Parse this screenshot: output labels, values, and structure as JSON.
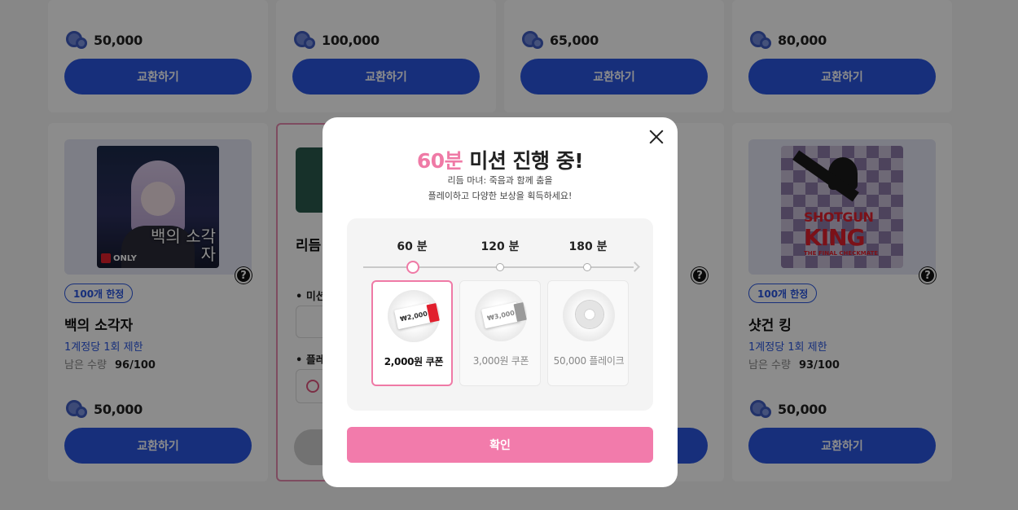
{
  "cards_top": [
    {
      "price": "50,000",
      "button": "교환하기"
    },
    {
      "price": "100,000",
      "button": "교환하기"
    },
    {
      "price": "65,000",
      "button": "교환하기"
    },
    {
      "price": "80,000",
      "button": "교환하기"
    }
  ],
  "cards_bottom": [
    {
      "badge": "100개 한정",
      "title": "백의 소각자",
      "limit": "1계정당 1회 제한",
      "remain_label": "남은 수량",
      "remain_value": "96/100",
      "price": "50,000",
      "button": "교환하기",
      "art_text": "백의 소각자",
      "art_tag": "ONLY"
    },
    {
      "title_partial": "리듬",
      "mission_partial": "미션",
      "play_partial": "플레"
    },
    {},
    {
      "badge": "100개 한정",
      "title": "샷건 킹",
      "limit": "1계정당 1회 제한",
      "remain_label": "남은 수량",
      "remain_value": "93/100",
      "price": "50,000",
      "button": "교환하기",
      "art_text_1": "SHOTGUN",
      "art_text_2": "KING",
      "art_text_3": "THE FINAL CHECKMATE"
    }
  ],
  "help_glyph": "?",
  "modal": {
    "title_highlight": "60분",
    "title_rest": " 미션 진행 중!",
    "desc_line1": "리듬 마녀: 죽음과 함께 춤을",
    "desc_line2": "플레이하고 다양한 보상을 획득하세요!",
    "steps": [
      {
        "label": "60 분",
        "active": true
      },
      {
        "label": "120 분",
        "active": false
      },
      {
        "label": "180 분",
        "active": false
      }
    ],
    "rewards": [
      {
        "label": "2,000원 쿠폰",
        "coupon_text": "₩2,000",
        "active": true
      },
      {
        "label": "3,000원 쿠폰",
        "coupon_text": "₩3,000",
        "active": false
      },
      {
        "label": "50,000 플레이크",
        "active": false
      }
    ],
    "confirm": "확인"
  },
  "colors": {
    "primary_blue": "#2a57e0",
    "pink": "#f27bab",
    "pink_text": "#ef7aa6"
  }
}
